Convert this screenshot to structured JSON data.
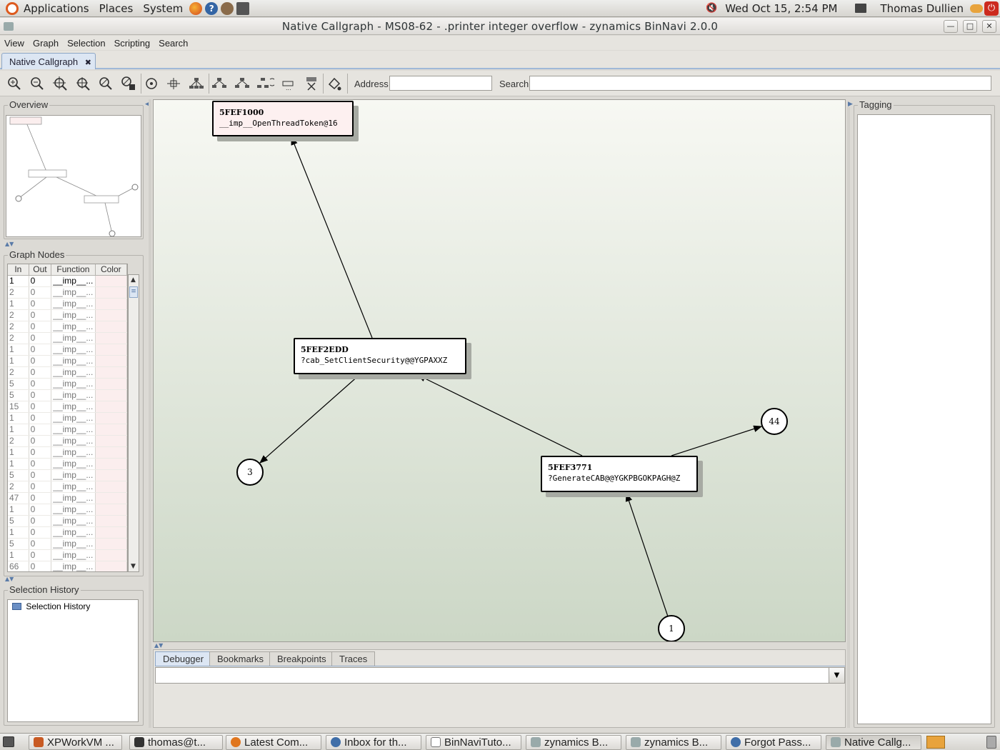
{
  "gnome_panel": {
    "menus": [
      "Applications",
      "Places",
      "System"
    ],
    "clock": "Wed Oct 15,  2:54 PM",
    "user": "Thomas Dullien"
  },
  "window": {
    "title": "Native Callgraph - MS08-62 - .printer integer overflow - zynamics BinNavi 2.0.0"
  },
  "menubar": [
    "View",
    "Graph",
    "Selection",
    "Scripting",
    "Search"
  ],
  "main_tab": {
    "label": "Native Callgraph",
    "close": "✖"
  },
  "toolbar": {
    "address_label": "Address",
    "address_value": "",
    "search_label": "Search",
    "search_value": "",
    "buttons": [
      "zoom-in-icon",
      "zoom-out-icon",
      "zoom-selection-icon",
      "zoom-fit-icon",
      "zoom-reset-icon",
      "zoom-lock-icon",
      "center-icon",
      "circular-layout-icon",
      "hierarchical-layout-icon",
      "orthogonal-layout-icon",
      "expand-layout-icon",
      "redo-layout-icon",
      "collapse-icon",
      "delete-icon",
      "color-node-icon"
    ]
  },
  "overview": {
    "title": "Overview"
  },
  "graph_nodes": {
    "title": "Graph Nodes",
    "columns": [
      "In",
      "Out",
      "Function",
      "Color"
    ],
    "rows": [
      [
        "1",
        "0",
        "__imp__..."
      ],
      [
        "2",
        "0",
        "__imp__..."
      ],
      [
        "1",
        "0",
        "__imp__..."
      ],
      [
        "2",
        "0",
        "__imp__..."
      ],
      [
        "2",
        "0",
        "__imp__..."
      ],
      [
        "2",
        "0",
        "__imp__..."
      ],
      [
        "1",
        "0",
        "__imp__..."
      ],
      [
        "1",
        "0",
        "__imp__..."
      ],
      [
        "2",
        "0",
        "__imp__..."
      ],
      [
        "5",
        "0",
        "__imp__..."
      ],
      [
        "5",
        "0",
        "__imp__..."
      ],
      [
        "15",
        "0",
        "__imp__..."
      ],
      [
        "1",
        "0",
        "__imp__..."
      ],
      [
        "1",
        "0",
        "__imp__..."
      ],
      [
        "2",
        "0",
        "__imp__..."
      ],
      [
        "1",
        "0",
        "__imp__..."
      ],
      [
        "1",
        "0",
        "__imp__..."
      ],
      [
        "5",
        "0",
        "__imp__..."
      ],
      [
        "2",
        "0",
        "__imp__..."
      ],
      [
        "47",
        "0",
        "__imp__..."
      ],
      [
        "1",
        "0",
        "__imp__..."
      ],
      [
        "5",
        "0",
        "__imp__..."
      ],
      [
        "1",
        "0",
        "__imp__..."
      ],
      [
        "5",
        "0",
        "__imp__..."
      ],
      [
        "1",
        "0",
        "__imp__..."
      ],
      [
        "66",
        "0",
        "__imp__..."
      ]
    ],
    "row_color": "#fbeeee"
  },
  "selection_history": {
    "title": "Selection History",
    "root_item": "Selection History"
  },
  "tagging": {
    "title": "Tagging"
  },
  "graph": {
    "nodes": [
      {
        "address": "5FEF1000",
        "function": "__imp__OpenThreadToken@16",
        "selected": true
      },
      {
        "address": "5FEF2EDD",
        "function": "?cab_SetClientSecurity@@YGPAXXZ",
        "selected": false
      },
      {
        "address": "5FEF3771",
        "function": "?GenerateCAB@@YGKPBGOKPAGH@Z",
        "selected": false
      }
    ],
    "collapsed": [
      "3",
      "44",
      "1"
    ]
  },
  "bottom_tabs": [
    "Debugger",
    "Bookmarks",
    "Breakpoints",
    "Traces"
  ],
  "taskbar": [
    {
      "label": "XPWorkVM ...",
      "active": false
    },
    {
      "label": "thomas@t...",
      "active": false
    },
    {
      "label": "Latest Com...",
      "active": false
    },
    {
      "label": "Inbox for th...",
      "active": false
    },
    {
      "label": "BinNaviTuto...",
      "active": false
    },
    {
      "label": "zynamics B...",
      "active": false
    },
    {
      "label": "zynamics B...",
      "active": false
    },
    {
      "label": "Forgot Pass...",
      "active": false
    },
    {
      "label": "Native Callg...",
      "active": true
    }
  ],
  "colors": {
    "accent": "#8ea7c7",
    "selected_node": "#fdf0f0",
    "graph_bg_top": "#f7f8f3",
    "graph_bg_bottom": "#ccd7c6"
  }
}
